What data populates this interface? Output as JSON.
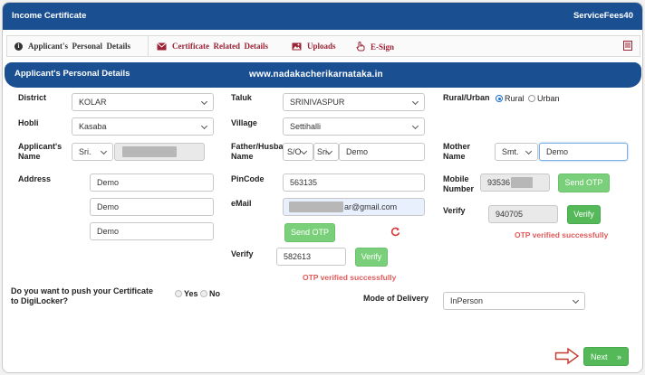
{
  "topbar": {
    "title": "Income Certificate",
    "fees": "ServiceFees40"
  },
  "tabs": [
    {
      "label": "Applicant's  Personal  Details",
      "icon": "info-icon"
    },
    {
      "label": "Certificate  Related  Details",
      "icon": "envelope-icon"
    },
    {
      "label": "Uploads",
      "icon": "image-icon"
    },
    {
      "label": "E-Sign",
      "icon": "hand-pointer-icon"
    }
  ],
  "section": {
    "title": "Applicant's Personal Details",
    "website": "www.nadakacherikarnataka.in"
  },
  "form": {
    "district": {
      "label": "District",
      "value": "KOLAR"
    },
    "hobli": {
      "label": "Hobli",
      "value": "Kasaba"
    },
    "applicant_name": {
      "label": "Applicant's Name",
      "salutation": "Sri."
    },
    "address": {
      "label": "Address",
      "lines": [
        "Demo",
        "Demo",
        "Demo"
      ]
    },
    "taluk": {
      "label": "Taluk",
      "value": "SRINIVASPUR"
    },
    "village": {
      "label": "Village",
      "value": "Settihalli"
    },
    "father_name": {
      "label": "Father/Husband Name",
      "relation": "S/O",
      "salutation": "Sri.",
      "value": "Demo"
    },
    "pincode": {
      "label": "PinCode",
      "value": "563135"
    },
    "email": {
      "label": "eMail",
      "value_suffix": "ar@gmail.com"
    },
    "email_send_otp": "Send OTP",
    "email_verify": {
      "label": "Verify",
      "value": "582613",
      "button": "Verify",
      "message": "OTP verified successfully"
    },
    "rural_urban": {
      "label": "Rural/Urban",
      "options": [
        "Rural",
        "Urban"
      ],
      "selected": "Rural"
    },
    "mother_name": {
      "label": "Mother Name",
      "salutation": "Smt.",
      "value": "Demo"
    },
    "mobile": {
      "label": "Mobile Number",
      "value_prefix": "93536"
    },
    "mobile_send_otp": "Send OTP",
    "mobile_verify": {
      "label": "Verify",
      "value": "940705",
      "button": "Verify",
      "message": "OTP verified successfully"
    },
    "digilocker": {
      "label": "Do you want to push your Certificate to DigiLocker?",
      "options": [
        "Yes",
        "No"
      ]
    },
    "delivery": {
      "label": "Mode of Delivery",
      "value": "InPerson"
    }
  },
  "next_button": {
    "label": "Next",
    "arrow": "»"
  },
  "colors": {
    "header": "#1a4f92",
    "success_text": "#e05a5a",
    "button_green": "#55b95a",
    "tab_link": "#9b2335"
  }
}
